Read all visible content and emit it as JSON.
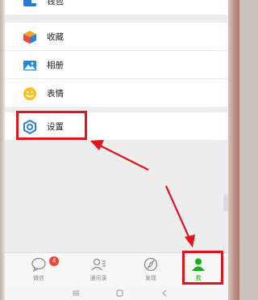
{
  "list": {
    "wallet_label": "钱包",
    "favorites_label": "收藏",
    "album_label": "相册",
    "stickers_label": "表情",
    "settings_label": "设置"
  },
  "tabbar": {
    "chats_label": "微信",
    "chats_badge": "4",
    "contacts_label": "通讯录",
    "discover_label": "发现",
    "me_label": "我"
  },
  "colors": {
    "accent": "#1aad19",
    "annotation_red": "#e1141e",
    "settings_icon": "#2f7fd8"
  }
}
